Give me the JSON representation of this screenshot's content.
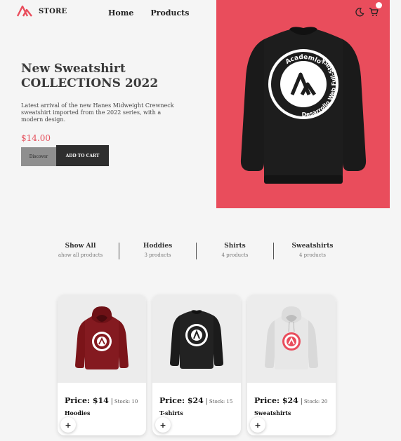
{
  "brand": {
    "name": "STORE",
    "accent": "#e94d5c"
  },
  "nav": [
    {
      "label": "Home"
    },
    {
      "label": "Products"
    }
  ],
  "header_icons": [
    "moon-icon",
    "cart-icon"
  ],
  "hero": {
    "title_line1": "New Sweatshirt",
    "title_line2": "COLLECTIONS 2022",
    "description": "Latest arrival of the new Hanes Midweight Crewneck sweatshirt imported from the 2022 series, with a modern design.",
    "price": "$14.00",
    "discover_label": "Discover",
    "add_to_cart_label": "ADD TO CART",
    "image_bg": "#e94d5c",
    "print_text_top": "Academlo",
    "print_text_bottom": "Desarrollo Web Full-Stack"
  },
  "filters": [
    {
      "title": "Show All",
      "subtitle": "ahow all products"
    },
    {
      "title": "Hoddies",
      "subtitle": "3 products"
    },
    {
      "title": "Shirts",
      "subtitle": "4 products"
    },
    {
      "title": "Sweatshirts",
      "subtitle": "4 products"
    }
  ],
  "products": [
    {
      "price": "Price: $14",
      "stock": "Stock: 10",
      "category": "Hoodies",
      "color": "#7b1419",
      "image": "hoodie"
    },
    {
      "price": "Price: $24",
      "stock": "Stock: 15",
      "category": "T-shirts",
      "color": "#1b1b1b",
      "image": "sweatshirt"
    },
    {
      "price": "Price: $24",
      "stock": "Stock: 20",
      "category": "Sweatshirts",
      "color": "#e7e7e7",
      "image": "hoodie"
    }
  ],
  "add_button_label": "+"
}
